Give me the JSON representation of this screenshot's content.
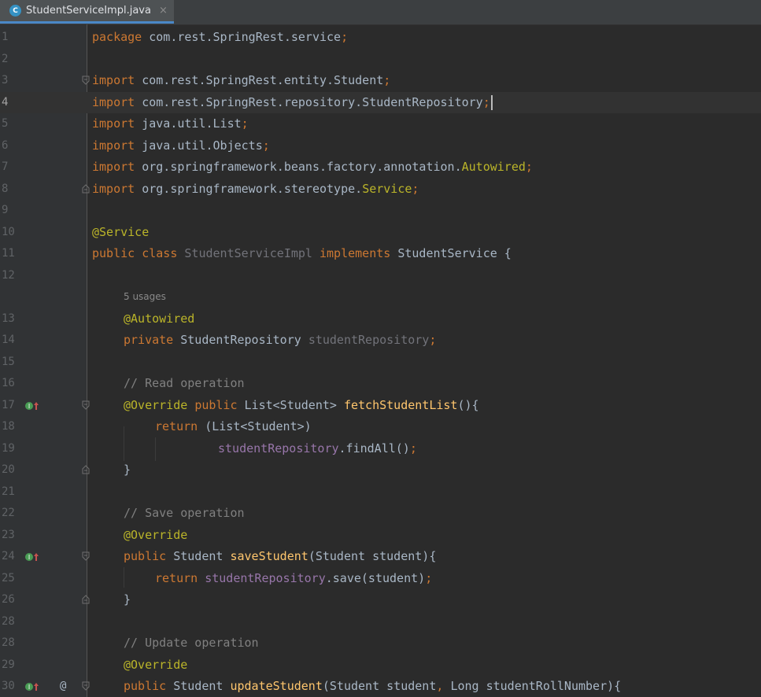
{
  "tab": {
    "title": "StudentServiceImpl.java",
    "icon_letter": "C",
    "close_glyph": "×"
  },
  "lines": [
    {
      "num": "1",
      "code": [
        {
          "t": "package ",
          "c": "kw"
        },
        {
          "t": "com.rest.SpringRest.service",
          "c": "plain"
        },
        {
          "t": ";",
          "c": "kw"
        }
      ]
    },
    {
      "num": "2",
      "code": []
    },
    {
      "num": "3",
      "code": [
        {
          "t": "import ",
          "c": "kw"
        },
        {
          "t": "com.rest.SpringRest.entity.Student",
          "c": "plain"
        },
        {
          "t": ";",
          "c": "kw"
        }
      ]
    },
    {
      "num": "4",
      "code": [
        {
          "t": "import ",
          "c": "kw"
        },
        {
          "t": "com.rest.SpringRest.repository.StudentRepository",
          "c": "plain"
        },
        {
          "t": ";",
          "c": "kw"
        }
      ]
    },
    {
      "num": "5",
      "code": [
        {
          "t": "import ",
          "c": "kw"
        },
        {
          "t": "java.util.List",
          "c": "plain"
        },
        {
          "t": ";",
          "c": "kw"
        }
      ]
    },
    {
      "num": "6",
      "code": [
        {
          "t": "import ",
          "c": "kw"
        },
        {
          "t": "java.util.Objects",
          "c": "plain"
        },
        {
          "t": ";",
          "c": "kw"
        }
      ]
    },
    {
      "num": "7",
      "code": [
        {
          "t": "import ",
          "c": "kw"
        },
        {
          "t": "org.springframework.beans.factory.annotation.",
          "c": "plain"
        },
        {
          "t": "Autowired",
          "c": "an"
        },
        {
          "t": ";",
          "c": "kw"
        }
      ]
    },
    {
      "num": "8",
      "code": [
        {
          "t": "import ",
          "c": "kw"
        },
        {
          "t": "org.springframework.stereotype.",
          "c": "plain"
        },
        {
          "t": "Service",
          "c": "an"
        },
        {
          "t": ";",
          "c": "kw"
        }
      ]
    },
    {
      "num": "9",
      "code": []
    },
    {
      "num": "10",
      "code": [
        {
          "t": "@Service",
          "c": "an"
        }
      ]
    },
    {
      "num": "11",
      "code": [
        {
          "t": "public class ",
          "c": "kw"
        },
        {
          "t": "StudentServiceImpl ",
          "c": "unused"
        },
        {
          "t": "implements ",
          "c": "kw"
        },
        {
          "t": "StudentService {",
          "c": "plain"
        }
      ]
    },
    {
      "num": "12",
      "code": []
    },
    {
      "num": "",
      "hint": "5 usages"
    },
    {
      "num": "13",
      "code": [
        {
          "t": "@Autowired",
          "c": "an"
        }
      ]
    },
    {
      "num": "14",
      "code": [
        {
          "t": "private ",
          "c": "kw"
        },
        {
          "t": "StudentRepository ",
          "c": "plain"
        },
        {
          "t": "studentRepository",
          "c": "unused"
        },
        {
          "t": ";",
          "c": "kw"
        }
      ]
    },
    {
      "num": "15",
      "code": []
    },
    {
      "num": "16",
      "code": [
        {
          "t": "// Read operation",
          "c": "cm"
        }
      ]
    },
    {
      "num": "17",
      "code": [
        {
          "t": "@Override ",
          "c": "an"
        },
        {
          "t": "public ",
          "c": "kw"
        },
        {
          "t": "List<Student> ",
          "c": "plain"
        },
        {
          "t": "fetchStudentList",
          "c": "fn"
        },
        {
          "t": "(){",
          "c": "plain"
        }
      ]
    },
    {
      "num": "18",
      "code": [
        {
          "t": "return ",
          "c": "kw"
        },
        {
          "t": "(List<Student>)",
          "c": "plain"
        }
      ]
    },
    {
      "num": "19",
      "code": [
        {
          "t": "studentRepository",
          "c": "fld"
        },
        {
          "t": ".findAll()",
          "c": "plain"
        },
        {
          "t": ";",
          "c": "kw"
        }
      ]
    },
    {
      "num": "20",
      "code": [
        {
          "t": "}",
          "c": "plain"
        }
      ]
    },
    {
      "num": "21",
      "code": []
    },
    {
      "num": "22",
      "code": [
        {
          "t": "// Save operation",
          "c": "cm"
        }
      ]
    },
    {
      "num": "23",
      "code": [
        {
          "t": "@Override",
          "c": "an"
        }
      ]
    },
    {
      "num": "24",
      "code": [
        {
          "t": "public ",
          "c": "kw"
        },
        {
          "t": "Student ",
          "c": "plain"
        },
        {
          "t": "saveStudent",
          "c": "fn"
        },
        {
          "t": "(Student student){",
          "c": "plain"
        }
      ]
    },
    {
      "num": "25",
      "code": [
        {
          "t": "return ",
          "c": "kw"
        },
        {
          "t": "studentRepository",
          "c": "fld"
        },
        {
          "t": ".save(student)",
          "c": "plain"
        },
        {
          "t": ";",
          "c": "kw"
        }
      ]
    },
    {
      "num": "26",
      "code": [
        {
          "t": "}",
          "c": "plain"
        }
      ]
    },
    {
      "num": "28",
      "code": []
    },
    {
      "num": "28",
      "code": [
        {
          "t": "// Update operation",
          "c": "cm"
        }
      ]
    },
    {
      "num": "29",
      "code": [
        {
          "t": "@Override",
          "c": "an"
        }
      ]
    },
    {
      "num": "30",
      "code": [
        {
          "t": "public ",
          "c": "kw"
        },
        {
          "t": "Student ",
          "c": "plain"
        },
        {
          "t": "updateStudent",
          "c": "fn"
        },
        {
          "t": "(Student student",
          "c": "plain"
        },
        {
          "t": ", ",
          "c": "kw"
        },
        {
          "t": "Long studentRollNumber){",
          "c": "plain"
        }
      ]
    }
  ],
  "gutter_at_symbol": "@",
  "colors": {
    "background": "#2b2b2b",
    "keyword": "#cc7832",
    "annotation": "#bbb529",
    "method": "#ffc66d",
    "field": "#9876aa",
    "comment": "#808080",
    "text": "#a9b7c6"
  }
}
